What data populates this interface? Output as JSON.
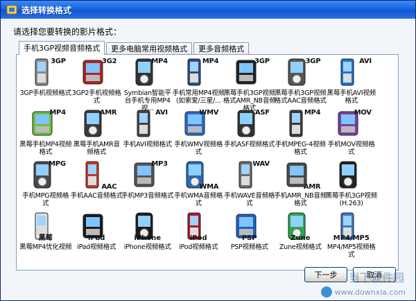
{
  "window": {
    "title": "选择转换格式"
  },
  "prompt": "请选择您要转换的影片格式：",
  "tabs": [
    {
      "label": "手机3GP视频音频格式",
      "active": true
    },
    {
      "label": "更多电脑常用视频格式",
      "active": false
    },
    {
      "label": "更多音频格式",
      "active": false
    }
  ],
  "items": [
    {
      "badge": "3GP",
      "caption": "3GP手机视频格式",
      "icon": "phone-silver-icon",
      "color": "#8a8a8a"
    },
    {
      "badge": "3G2",
      "caption": "3GP2手机视频格式",
      "icon": "phone-red-icon",
      "color": "#b22222"
    },
    {
      "badge": "MP4",
      "caption": "Symbian智能平台手机专用MP4视...",
      "icon": "smartphone-dark-icon",
      "color": "#333333"
    },
    {
      "badge": "MP4",
      "caption": "手机常用MP4视频(如索爱/三星/...",
      "icon": "phone-flip-icon",
      "color": "#2f4f7f"
    },
    {
      "badge": "3GP",
      "caption": "黑莓手机3GP视频格式AMR_NB音频格式",
      "icon": "blackberry-icon",
      "color": "#222222"
    },
    {
      "badge": "3GP",
      "caption": "黑莓手机3GP视频格式AAC音频格式",
      "icon": "phone-keypad-icon",
      "color": "#555555"
    },
    {
      "badge": "AVI",
      "caption": "黑莓手机AVI视频格式",
      "icon": "phone-media-icon",
      "color": "#1e6fd9"
    },
    {
      "badge": "MP4",
      "caption": "黑莓手机MP4视频格式",
      "icon": "phone-disc-icon",
      "color": "#6fbf3a"
    },
    {
      "badge": "AMR",
      "caption": "黑莓手机AMR音频格式",
      "icon": "blackberry-audio-icon",
      "color": "#3a3a3a"
    },
    {
      "badge": "AVI",
      "caption": "手机AVI视频格式",
      "icon": "phone-slider-icon",
      "color": "#444444"
    },
    {
      "badge": "WMV",
      "caption": "手机WMV视频格式",
      "icon": "phone-wmv-icon",
      "color": "#2b6cc4"
    },
    {
      "badge": "ASF",
      "caption": "手机ASF视频格式",
      "icon": "phone-film-icon",
      "color": "#333333"
    },
    {
      "badge": "MP4",
      "caption": "手机MPEG-4视频格式",
      "icon": "phone-qwerty-icon",
      "color": "#3a3a3a"
    },
    {
      "badge": "MOV",
      "caption": "手机MOV视频格式",
      "icon": "phone-quicktime-icon",
      "color": "#7b3fa0"
    },
    {
      "badge": "MPG",
      "caption": "手机MPG视频格式",
      "icon": "phone-mpg-icon",
      "color": "#4a4a4a"
    },
    {
      "badge": "AAC",
      "caption": "手机AAC音频格式",
      "icon": "phone-aac-icon",
      "color": "#c0392b"
    },
    {
      "badge": "MP3",
      "caption": "手机MP3音频格式",
      "icon": "phone-mp3-icon",
      "color": "#555555"
    },
    {
      "badge": "WMA",
      "caption": "手机WMA音频格式",
      "icon": "phone-wma-icon",
      "color": "#2a6ab8"
    },
    {
      "badge": "WAV",
      "caption": "手机WAVE音频格式",
      "icon": "phone-wav-icon",
      "color": "#6a6a6a"
    },
    {
      "badge": "AMR",
      "caption": "手机AMR_NB音频格式",
      "icon": "phone-amr-icon",
      "color": "#4a4a4a"
    },
    {
      "badge": "",
      "caption": "黑莓手机3GP视频(H.263)",
      "icon": "blackberry-h263-icon",
      "color": "#222222"
    },
    {
      "device": "黑莓",
      "caption": "黑莓MP4优化视频",
      "icon": "blackberry-white-icon",
      "color": "#dddddd"
    },
    {
      "device": "iPad",
      "caption": "iPad视频格式",
      "icon": "ipad-icon",
      "color": "#1a1a1a"
    },
    {
      "device": "iPhone",
      "caption": "iPhone视频格式",
      "icon": "iphone-icon",
      "color": "#1a1a1a"
    },
    {
      "device": "iPod",
      "caption": "iPod视频格式",
      "icon": "ipod-icon",
      "color": "#b0162a"
    },
    {
      "device": "PSP",
      "caption": "PSP视频格式",
      "icon": "psp-icon",
      "color": "#2060c0"
    },
    {
      "device": "Zune",
      "caption": "Zune视频格式",
      "icon": "zune-icon",
      "color": "#2aa84a"
    },
    {
      "device": "MP4/MP5",
      "caption": "MP4/MP5视频格式",
      "icon": "mp4-player-icon",
      "color": "#3a78c8"
    }
  ],
  "buttons": {
    "next": "下一步",
    "cancel": "取消"
  },
  "watermark": {
    "site": "www.downxia.com",
    "name": "当下软件园"
  }
}
